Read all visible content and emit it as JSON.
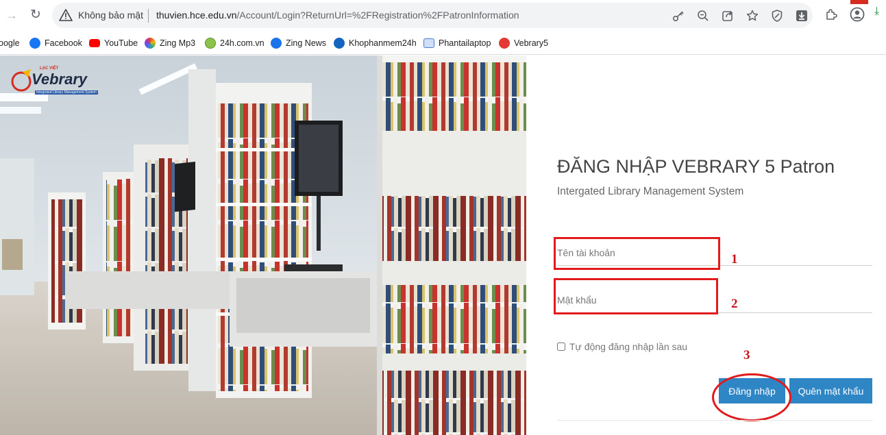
{
  "browser": {
    "security_label": "Không bảo mật",
    "url_host": "thuvien.hce.edu.vn",
    "url_path": "/Account/Login?ReturnUrl=%2FRegistration%2FPatronInformation"
  },
  "bookmarks": [
    {
      "label": "oogle",
      "icon": "google-icon",
      "color": "#4285f4"
    },
    {
      "label": "Facebook",
      "icon": "facebook-icon",
      "color": "#1877f2"
    },
    {
      "label": "YouTube",
      "icon": "youtube-icon",
      "color": "#ff0000"
    },
    {
      "label": "Zing Mp3",
      "icon": "zingmp3-icon",
      "color": "#8d3bd6"
    },
    {
      "label": "24h.com.vn",
      "icon": "24h-icon",
      "color": "#6aa84f"
    },
    {
      "label": "Zing News",
      "icon": "zingnews-icon",
      "color": "#1a73e8"
    },
    {
      "label": "Khophanmem24h",
      "icon": "khophanmem-icon",
      "color": "#1565c0"
    },
    {
      "label": "Phantailaptop",
      "icon": "phantailaptop-icon",
      "color": "#4a7bd0"
    },
    {
      "label": "Vebrary5",
      "icon": "vebrary-icon",
      "color": "#e53935"
    }
  ],
  "logo": {
    "brand": "Vebrary",
    "tagline": "LẠC VIỆT",
    "subtitle": "Integrated Library Management System"
  },
  "login": {
    "title": "ĐĂNG NHẬP VEBRARY 5 Patron",
    "subtitle": "Intergated Library Management System",
    "username_placeholder": "Tên tài khoản",
    "password_placeholder": "Mật khẩu",
    "remember_label": "Tự động đăng nhập lần sau",
    "login_button": "Đăng nhập",
    "forgot_button": "Quên mật khẩu"
  },
  "annotations": {
    "step1": "1",
    "step2": "2",
    "step3": "3"
  },
  "colors": {
    "button": "#2f86c5",
    "annotation_red": "#e11b1b"
  }
}
